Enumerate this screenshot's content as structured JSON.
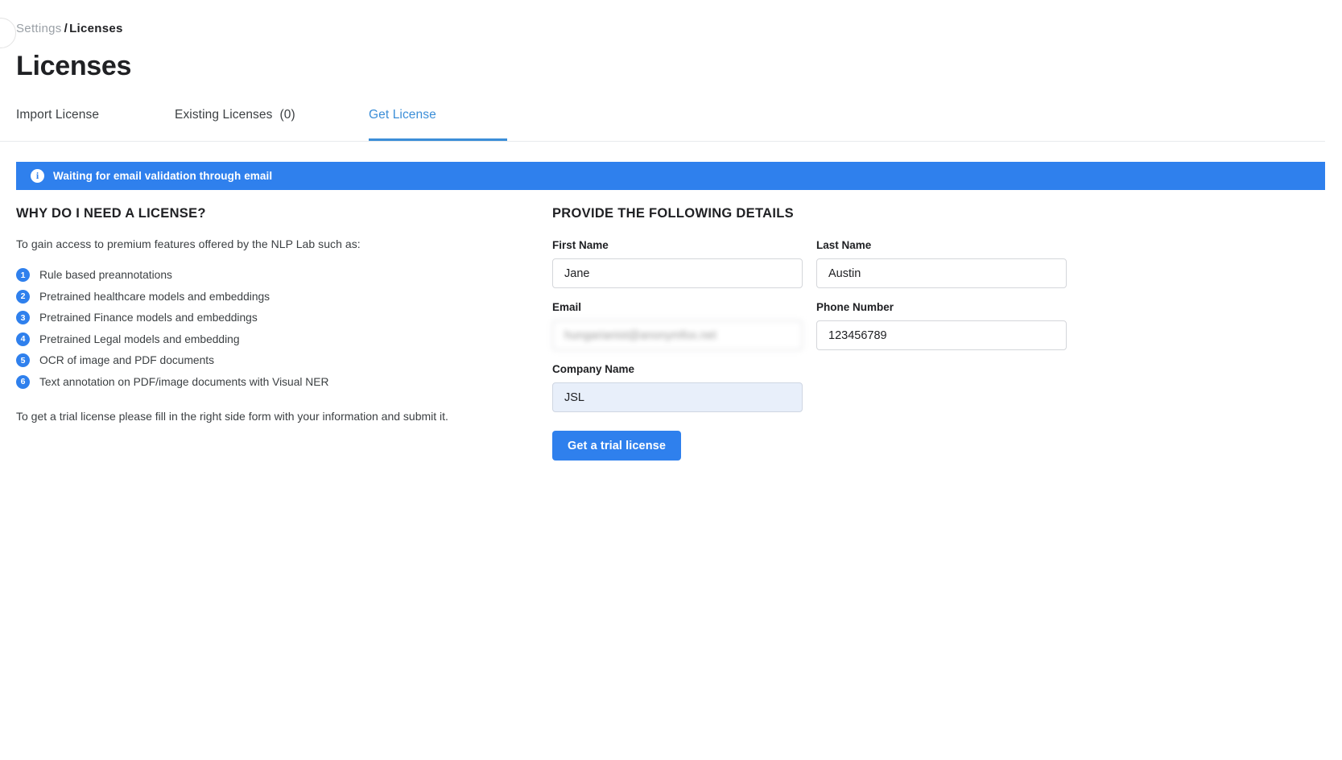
{
  "breadcrumb": {
    "parent": "Settings",
    "separator": "/",
    "current": "Licenses"
  },
  "page_title": "Licenses",
  "tabs": [
    {
      "label": "Import License",
      "count": "",
      "active": false
    },
    {
      "label": "Existing Licenses",
      "count": "(0)",
      "active": false
    },
    {
      "label": "Get License",
      "count": "",
      "active": true
    }
  ],
  "banner": {
    "icon": "info-icon",
    "text": "Waiting for email validation through email",
    "background_color": "#2f80ed"
  },
  "left_column": {
    "heading": "WHY DO I NEED A LICENSE?",
    "intro": "To gain access to premium features offered by the NLP Lab such as:",
    "features": [
      {
        "num": "1",
        "label": "Rule based preannotations"
      },
      {
        "num": "2",
        "label": "Pretrained healthcare models and embeddings"
      },
      {
        "num": "3",
        "label": "Pretrained Finance models and embeddings"
      },
      {
        "num": "4",
        "label": "Pretrained Legal models and embedding"
      },
      {
        "num": "5",
        "label": "OCR of image and PDF documents"
      },
      {
        "num": "6",
        "label": "Text annotation on PDF/image documents with Visual NER"
      }
    ],
    "outro": "To get a trial license please fill in the right side form with your information and submit it."
  },
  "form": {
    "heading": "PROVIDE THE FOLLOWING DETAILS",
    "fields": {
      "first_name": {
        "label": "First Name",
        "value": "Jane",
        "placeholder": ""
      },
      "last_name": {
        "label": "Last Name",
        "value": "Austin",
        "placeholder": ""
      },
      "email": {
        "label": "Email",
        "value": "hungarianist@anonymfox.net",
        "placeholder": ""
      },
      "phone_number": {
        "label": "Phone Number",
        "value": "123456789",
        "placeholder": ""
      },
      "company_name": {
        "label": "Company Name",
        "value": "JSL",
        "placeholder": ""
      }
    },
    "submit_label": "Get a trial license",
    "accent_color": "#2f80ed"
  }
}
